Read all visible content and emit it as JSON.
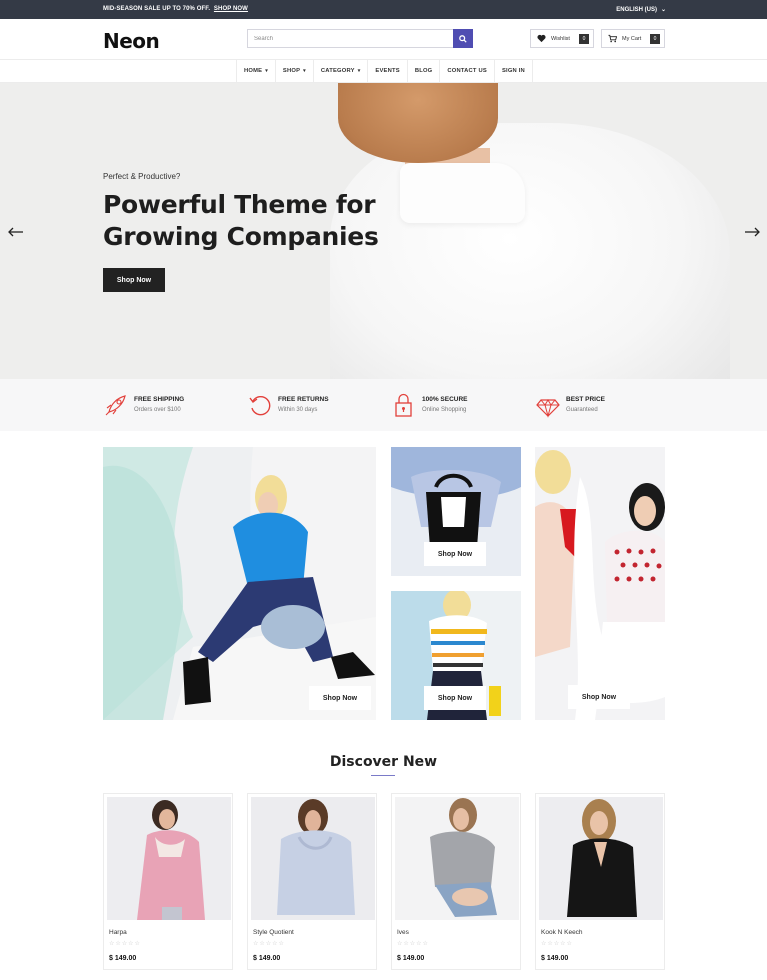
{
  "topbar": {
    "promo_text": "MID-SEASON SALE UP TO 70% OFF.",
    "promo_link": "SHOP NOW",
    "language": "ENGLISH (US)"
  },
  "header": {
    "logo": "Neon",
    "search_placeholder": "Search",
    "wishlist_label": "Wishlist",
    "wishlist_count": "0",
    "cart_label": "My Cart",
    "cart_count": "0"
  },
  "nav": {
    "items": [
      "HOME",
      "SHOP",
      "CATEGORY",
      "EVENTS",
      "BLOG",
      "CONTACT US",
      "SIGN IN"
    ]
  },
  "hero": {
    "eyebrow": "Perfect & Productive?",
    "headline": "Powerful Theme for Growing Companies",
    "button": "Shop Now"
  },
  "features": [
    {
      "title": "FREE SHIPPING",
      "subtitle": "Orders over $100",
      "icon": "rocket-icon"
    },
    {
      "title": "FREE RETURNS",
      "subtitle": "Within 30 days",
      "icon": "return-icon"
    },
    {
      "title": "100% SECURE",
      "subtitle": "Online Shopping",
      "icon": "lock-icon"
    },
    {
      "title": "BEST PRICE",
      "subtitle": "Guaranteed",
      "icon": "diamond-icon"
    }
  ],
  "banners": {
    "cta": "Shop Now"
  },
  "discover": {
    "title": "Discover New",
    "products": [
      {
        "name": "Harpa",
        "price": "$ 149.00",
        "rating": "☆☆☆☆☆"
      },
      {
        "name": "Style Quotient",
        "price": "$ 149.00",
        "rating": "☆☆☆☆☆"
      },
      {
        "name": "Ives",
        "price": "$ 149.00",
        "rating": "☆☆☆☆☆"
      },
      {
        "name": "Kook N Keech",
        "price": "$ 149.00",
        "rating": "☆☆☆☆☆"
      }
    ]
  },
  "colors": {
    "accent": "#4f4db2",
    "topbar": "#343a46",
    "feature_icon": "#e2403b"
  }
}
